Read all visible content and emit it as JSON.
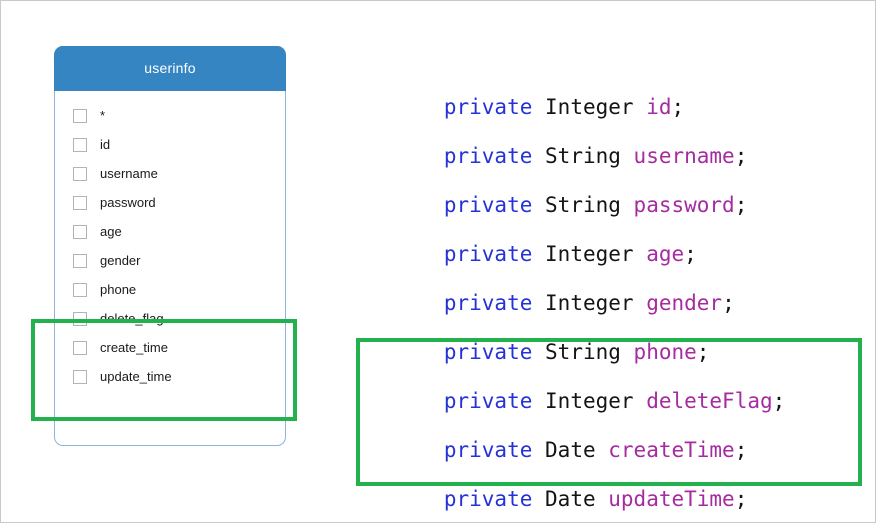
{
  "table_panel": {
    "title": "userinfo",
    "header_color": "#3585c3",
    "border_color": "#8cb4dd",
    "fields": [
      {
        "label": "*",
        "checked": false
      },
      {
        "label": "id",
        "checked": false
      },
      {
        "label": "username",
        "checked": false
      },
      {
        "label": "password",
        "checked": false
      },
      {
        "label": "age",
        "checked": false
      },
      {
        "label": "gender",
        "checked": false
      },
      {
        "label": "phone",
        "checked": false
      },
      {
        "label": "delete_flag",
        "checked": false
      },
      {
        "label": "create_time",
        "checked": false
      },
      {
        "label": "update_time",
        "checked": false
      }
    ]
  },
  "code": {
    "keyword_color": "#2432d6",
    "type_color": "#141414",
    "identifier_color": "#a62ba0",
    "lines": [
      {
        "keyword": "private",
        "type": "Integer",
        "name": "id",
        "terminator": ";"
      },
      {
        "keyword": "private",
        "type": "String",
        "name": "username",
        "terminator": ";"
      },
      {
        "keyword": "private",
        "type": "String",
        "name": "password",
        "terminator": ";"
      },
      {
        "keyword": "private",
        "type": "Integer",
        "name": "age",
        "terminator": ";"
      },
      {
        "keyword": "private",
        "type": "Integer",
        "name": "gender",
        "terminator": ";"
      },
      {
        "keyword": "private",
        "type": "String",
        "name": "phone",
        "terminator": ";"
      },
      {
        "keyword": "private",
        "type": "Integer",
        "name": "deleteFlag",
        "terminator": ";"
      },
      {
        "keyword": "private",
        "type": "Date",
        "name": "createTime",
        "terminator": ";"
      },
      {
        "keyword": "private",
        "type": "Date",
        "name": "updateTime",
        "terminator": ";"
      }
    ]
  },
  "highlights": {
    "color": "#22b14c",
    "left_box_fields": [
      "delete_flag",
      "create_time",
      "update_time"
    ],
    "right_box_lines": [
      "deleteFlag",
      "createTime",
      "updateTime"
    ]
  }
}
